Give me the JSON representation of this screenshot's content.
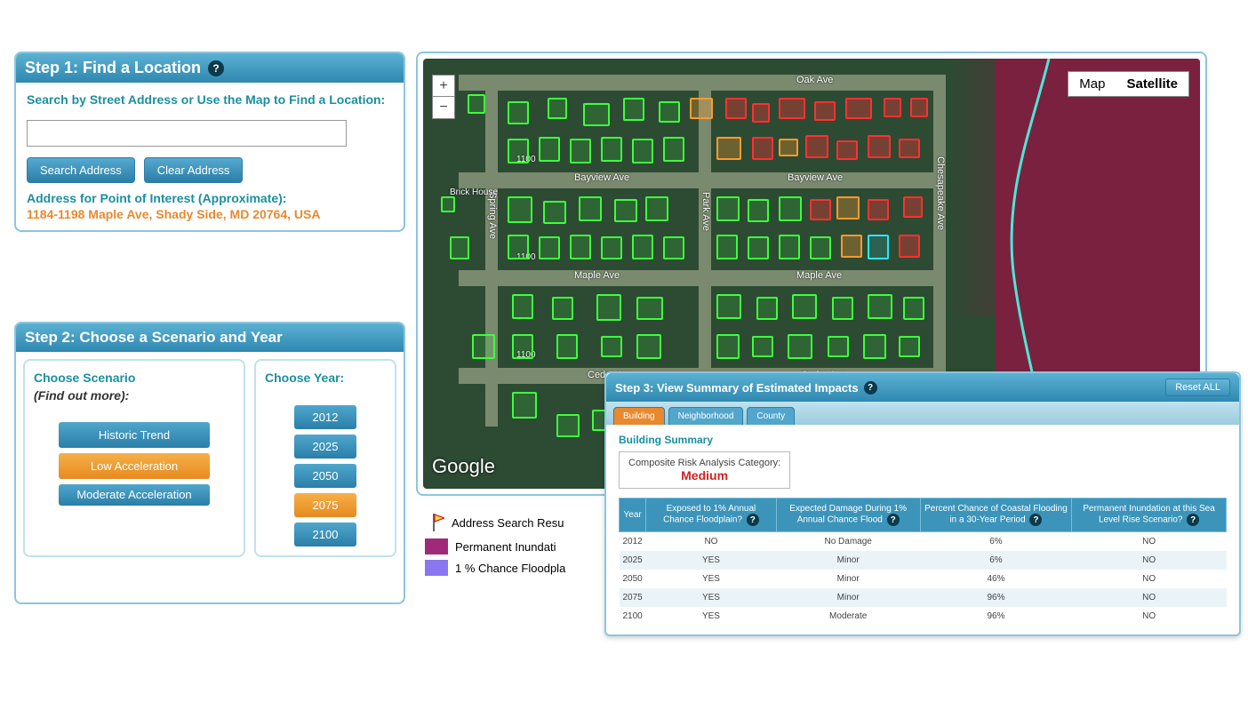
{
  "step1": {
    "title": "Step 1: Find a Location",
    "search_label": "Search by Street Address or Use the Map to Find a Location:",
    "search_value": "",
    "search_btn": "Search Address",
    "clear_btn": "Clear Address",
    "poi_label": "Address for Point of Interest (Approximate):",
    "poi_value": "1184-1198 Maple Ave, Shady Side, MD 20764, USA"
  },
  "step2": {
    "title": "Step 2: Choose a Scenario and Year",
    "scenario_label": "Choose Scenario",
    "scenario_help": "(Find out more):",
    "year_label": "Choose Year:",
    "scenarios": [
      "Historic Trend",
      "Low Acceleration",
      "Moderate Acceleration"
    ],
    "scenario_selected": "Low Acceleration",
    "years": [
      "2012",
      "2025",
      "2050",
      "2075",
      "2100"
    ],
    "year_selected": "2075"
  },
  "map": {
    "zoom_in": "+",
    "zoom_out": "−",
    "type_map": "Map",
    "type_satellite": "Satellite",
    "attrib": "Google",
    "streets": {
      "oak": "Oak Ave",
      "bayview1": "Bayview Ave",
      "bayview2": "Bayview Ave",
      "maple1": "Maple Ave",
      "maple2": "Maple Ave",
      "cedar1": "Cedar Ave",
      "cedar2": "Cedar Ave",
      "spring": "Spring Ave",
      "park": "Park Ave",
      "chesapeake": "Chesapeake Ave",
      "brick": "Brick House",
      "n1100a": "1100",
      "n1100b": "1100",
      "n1100c": "1100"
    }
  },
  "legend": {
    "addr": "Address Search Resu",
    "perm": "Permanent Inundati",
    "onepct": "1 % Chance Floodpla"
  },
  "step3": {
    "title": "Step 3: View Summary of Estimated Impacts",
    "reset": "Reset ALL",
    "tabs": {
      "building": "Building",
      "neighborhood": "Neighborhood",
      "county": "County"
    },
    "body_title": "Building Summary",
    "risk_label": "Composite Risk Analysis Category:",
    "risk_value": "Medium",
    "headers": {
      "year": "Year",
      "exposed": "Exposed to 1% Annual Chance Floodplain?",
      "damage": "Expected Damage During 1% Annual Chance Flood",
      "coastal": "Percent Chance of Coastal Flooding in a 30-Year Period",
      "perm": "Permanent Inundation at this Sea Level Rise Scenario?"
    },
    "rows": [
      {
        "year": "2012",
        "exposed": "NO",
        "damage": "No Damage",
        "coastal": "6%",
        "perm": "NO"
      },
      {
        "year": "2025",
        "exposed": "YES",
        "damage": "Minor",
        "coastal": "6%",
        "perm": "NO"
      },
      {
        "year": "2050",
        "exposed": "YES",
        "damage": "Minor",
        "coastal": "46%",
        "perm": "NO"
      },
      {
        "year": "2075",
        "exposed": "YES",
        "damage": "Minor",
        "coastal": "96%",
        "perm": "NO"
      },
      {
        "year": "2100",
        "exposed": "YES",
        "damage": "Moderate",
        "coastal": "96%",
        "perm": "NO"
      }
    ]
  },
  "colors": {
    "magenta": "#a02a7a",
    "purple": "#8a76f0"
  }
}
